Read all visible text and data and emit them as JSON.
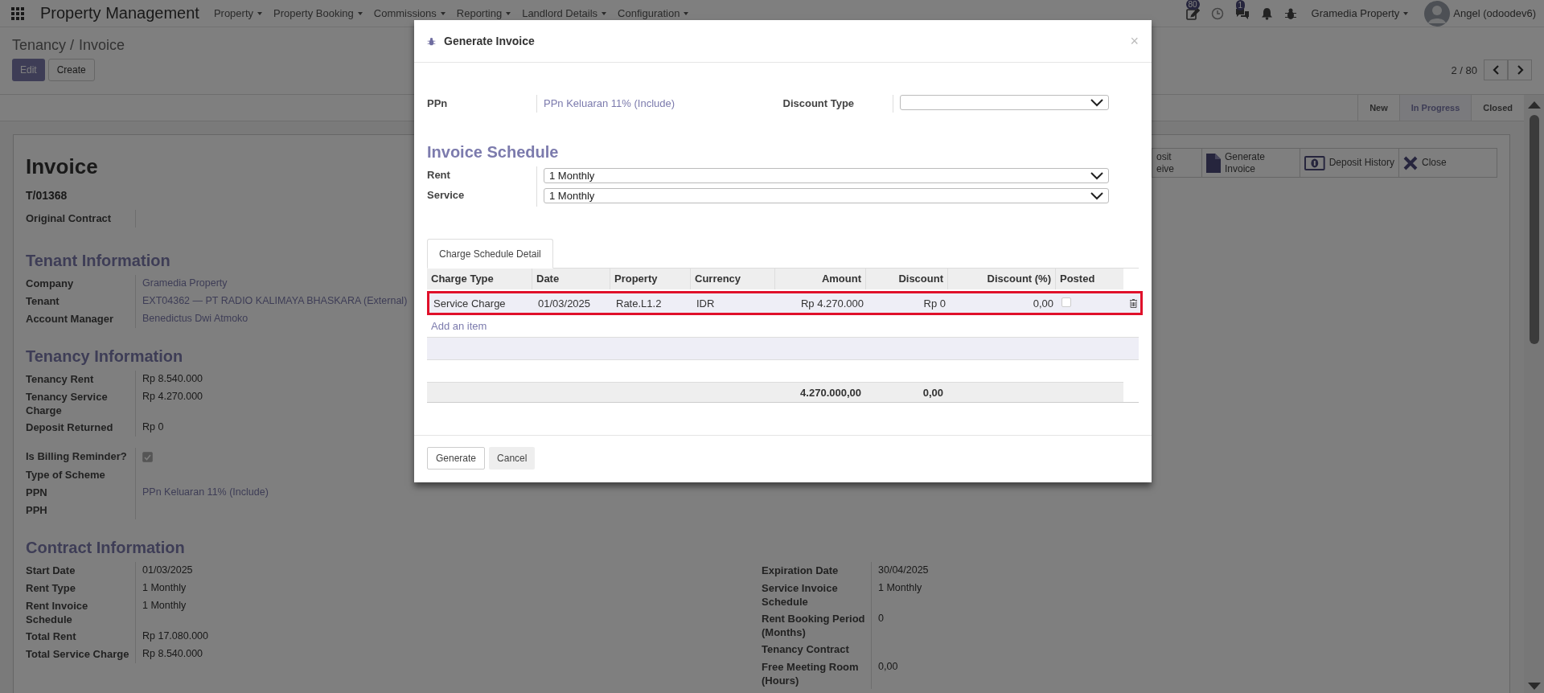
{
  "navbar": {
    "app_title": "Property Management",
    "menus": [
      "Property",
      "Property Booking",
      "Commissions",
      "Reporting",
      "Landlord Details",
      "Configuration"
    ],
    "activity_count": "80",
    "message_count": "1",
    "company": "Gramedia Property",
    "user": "Angel (odoodev6)"
  },
  "breadcrumb": {
    "parent": "Tenancy /",
    "current": "Invoice"
  },
  "actions": [
    {
      "label": "Edit",
      "kind": "primary"
    },
    {
      "label": "Create",
      "kind": "secondary"
    }
  ],
  "pager": {
    "text": "2 / 80"
  },
  "statuses": [
    {
      "label": "New",
      "selected": false
    },
    {
      "label": "In Progress",
      "selected": true
    },
    {
      "label": "Closed",
      "selected": false
    }
  ],
  "sheet": {
    "header_buttons": [
      {
        "lines": [
          "osit",
          "eive"
        ],
        "kind": "partial"
      },
      {
        "lines": [
          "Generate",
          "Invoice"
        ],
        "kind": "document"
      },
      {
        "lines": [
          "Deposit History"
        ],
        "kind": "money"
      },
      {
        "lines": [
          "Close"
        ],
        "kind": "cross"
      }
    ],
    "title": "Invoice",
    "reference": "T/01368",
    "top_fields": [
      {
        "label": "Original Contract"
      }
    ],
    "sections": [
      {
        "title": "Tenant Information",
        "left": [
          [
            {
              "label": "Company",
              "value": "Gramedia Property",
              "kind": "link"
            },
            {
              "label": "Tenant",
              "value": "EXT04362 — PT RADIO KALIMAYA BHASKARA (External)",
              "kind": "link"
            },
            {
              "label": "Account Manager",
              "value": "Benedictus Dwi Atmoko",
              "kind": "link"
            }
          ]
        ]
      },
      {
        "title": "Tenancy Information",
        "left": [
          [
            {
              "label": "Tenancy Rent",
              "value": "Rp 8.540.000",
              "kind": "text"
            },
            {
              "label": "Tenancy Service Charge",
              "value": "Rp 4.270.000",
              "kind": "text"
            },
            {
              "label": "Deposit Returned",
              "value": "Rp 0",
              "kind": "text"
            }
          ],
          [
            {
              "label": "Is Billing Reminder?",
              "kind": "checkbox",
              "checked": true
            },
            {
              "label": "Type of Scheme",
              "kind": "text"
            },
            {
              "label": "PPN",
              "value": "PPn Keluaran 11% (Include)",
              "kind": "link"
            },
            {
              "label": "PPH",
              "kind": "text"
            }
          ]
        ]
      },
      {
        "title": "Contract Information",
        "left": [
          [
            {
              "label": "Start Date",
              "value": "01/03/2025",
              "kind": "text"
            },
            {
              "label": "Rent Type",
              "value": "1 Monthly",
              "kind": "text"
            },
            {
              "label": "Rent Invoice Schedule",
              "value": "1 Monthly",
              "kind": "text"
            },
            {
              "label": "Total Rent",
              "value": "Rp 17.080.000",
              "kind": "text"
            },
            {
              "label": "Total Service Charge",
              "value": "Rp 8.540.000",
              "kind": "text"
            }
          ]
        ],
        "right": [
          [
            {
              "label": "Expiration Date",
              "value": "30/04/2025",
              "kind": "text"
            },
            {
              "label": "Service Invoice Schedule",
              "value": "1 Monthly",
              "kind": "text"
            },
            {
              "label": "Rent Booking Period (Months)",
              "value": "0",
              "kind": "text"
            },
            {
              "label": "Tenancy Contract",
              "kind": "text"
            },
            {
              "label": "Free Meeting Room (Hours)",
              "value": "0,00",
              "kind": "text"
            }
          ]
        ]
      }
    ]
  },
  "dialog": {
    "title": "Generate Invoice",
    "close": "×",
    "ppn": {
      "label": "PPn",
      "value": "PPn Keluaran 11% (Include)"
    },
    "discount_type": {
      "label": "Discount Type"
    },
    "schedule_title": "Invoice Schedule",
    "schedule": [
      {
        "label": "Rent",
        "value": "1 Monthly"
      },
      {
        "label": "Service",
        "value": "1 Monthly"
      }
    ],
    "tabs": [
      {
        "label": "Charge Schedule Detail",
        "selected": true
      }
    ],
    "columns": [
      "Charge Type",
      "Date",
      "Property",
      "Currency",
      "Amount",
      "Discount",
      "Discount (%)",
      "Posted"
    ],
    "rows": [
      {
        "cells": [
          "Service Charge",
          "01/03/2025",
          "Rate.L1.2",
          "IDR",
          "Rp 4.270.000",
          "Rp 0",
          "0,00"
        ],
        "posted": false,
        "highlighted": true
      }
    ],
    "add_item": "Add an item",
    "totals": {
      "amount": "4.270.000,00",
      "discount": "0,00"
    },
    "buttons": [
      {
        "label": "Generate",
        "kind": "outline"
      },
      {
        "label": "Cancel",
        "kind": "light"
      }
    ]
  }
}
